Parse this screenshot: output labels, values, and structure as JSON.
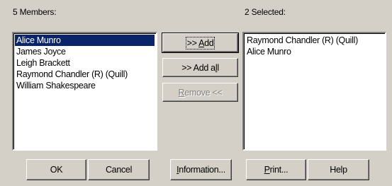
{
  "members_label": "5 Members:",
  "selected_label": "2 Selected:",
  "members": [
    "Alice Munro",
    "James Joyce",
    "Leigh Brackett",
    "Raymond Chandler (R) (Quill)",
    "William Shakespeare"
  ],
  "selected": [
    "Raymond Chandler (R) (Quill)",
    "Alice Munro"
  ],
  "buttons": {
    "add_prefix": ">> ",
    "add_key": "A",
    "add_rest": "dd",
    "add_all_prefix": ">> Add a",
    "add_all_key": "l",
    "add_all_rest": "l",
    "remove_key": "R",
    "remove_rest": "emove <<",
    "ok": "OK",
    "cancel": "Cancel",
    "info_key": "I",
    "info_rest": "nformation...",
    "print_key": "P",
    "print_rest": "rint...",
    "help": "Help"
  },
  "colors": {
    "face": "#d4d0c8",
    "selection": "#0a246a"
  }
}
